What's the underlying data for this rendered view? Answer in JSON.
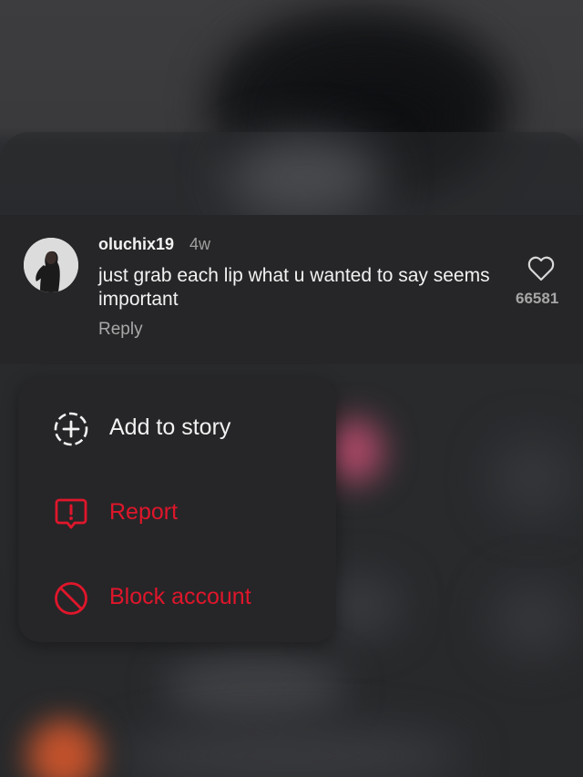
{
  "comment": {
    "username": "oluchix19",
    "time_ago": "4w",
    "text": "just grab each lip what u wanted to say seems important",
    "reply_label": "Reply",
    "like_count": "66581",
    "avatar_icon": "profile-photo"
  },
  "menu": {
    "items": [
      {
        "label": "Add to story",
        "icon": "add-to-story-icon",
        "color": "#f2f2f2"
      },
      {
        "label": "Report",
        "icon": "report-icon",
        "color": "#e0162b"
      },
      {
        "label": "Block account",
        "icon": "block-icon",
        "color": "#e0162b"
      }
    ]
  },
  "colors": {
    "danger": "#e0162b",
    "card_bg": "#262628",
    "text_primary": "#f2f2f2",
    "text_secondary": "#a0a0a0"
  }
}
